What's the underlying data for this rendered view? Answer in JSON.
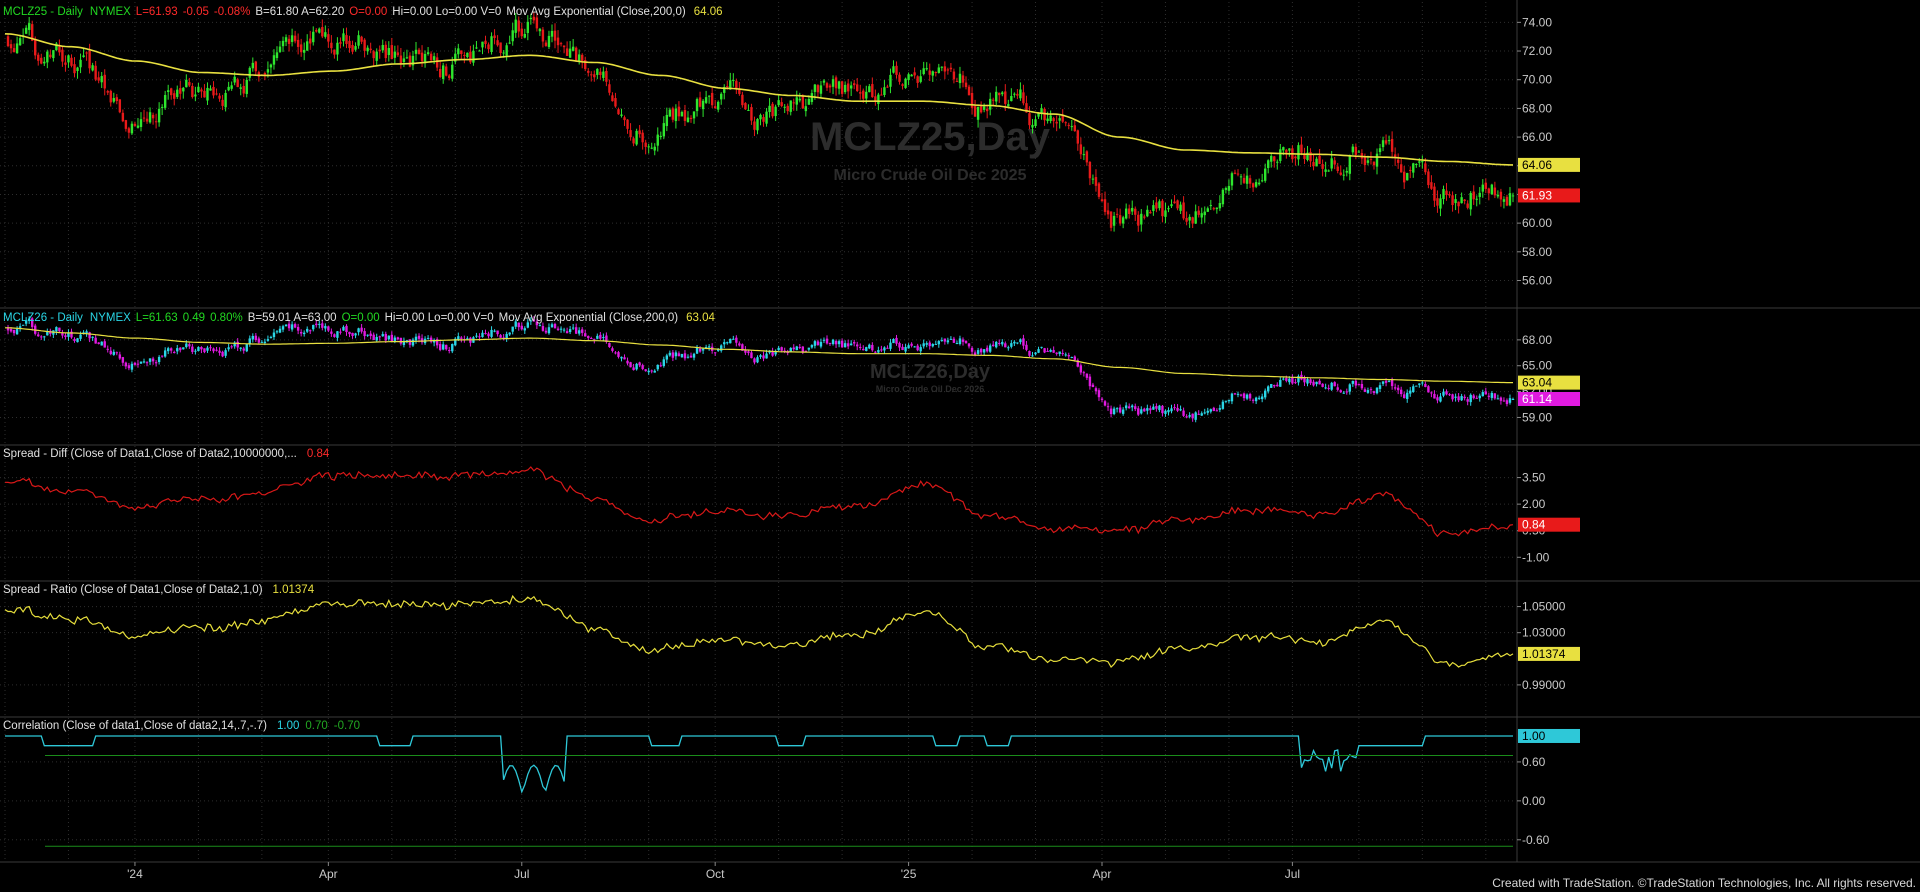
{
  "footer": "Created with TradeStation. ©TradeStation Technologies, Inc. All rights reserved.",
  "colors": {
    "background": "#000000",
    "grid": "#2e2e2e",
    "axis_text": "#c8c8c8",
    "up_bar": "#2ee62e",
    "down_bar": "#e81a1a",
    "ema": "#e8e040",
    "mclz26_up": "#2ad6e6",
    "mclz26_down": "#e01ae0",
    "spread_diff": "#d81818",
    "spread_ratio": "#e6de3c",
    "correlation": "#2ec8d8",
    "corr_levels": "#1a8c1a",
    "green_text": "#22d822",
    "red_text": "#ff2a2a",
    "cyan_text": "#2ad6e6"
  },
  "x_axis": {
    "labels": [
      "'24",
      "Apr",
      "Jul",
      "Oct",
      "'25",
      "Apr",
      "Jul"
    ]
  },
  "panes": [
    {
      "id": "mclz25",
      "header": {
        "symbol": "MCLZ25 - Daily",
        "exchange": "NYMEX",
        "last": "L=61.93",
        "change": "-0.05",
        "pct": "-0.08%",
        "rest": "B=61.80  A=62.20",
        "open": "O=0.00",
        "stats": "Hi=0.00  Lo=0.00  V=0",
        "study": "Mov Avg Exponential (Close,200,0)",
        "study_value": "64.06"
      },
      "watermark": {
        "title": "MCLZ25,Day",
        "subtitle": "Micro Crude Oil Dec 2025"
      },
      "ticks": [
        "74.00",
        "72.00",
        "70.00",
        "68.00",
        "66.00",
        "64.00",
        "62.00",
        "60.00",
        "58.00",
        "56.00"
      ],
      "badges": [
        {
          "text": "64.06",
          "value": 64.06,
          "kind": "ema"
        },
        {
          "text": "61.93",
          "value": 61.93,
          "kind": "last"
        }
      ]
    },
    {
      "id": "mclz26",
      "header": {
        "symbol": "MCLZ26 - Daily",
        "exchange": "NYMEX",
        "last": "L=61.63",
        "change": "0.49",
        "pct": "0.80%",
        "rest": "B=59.01  A=63.00",
        "open": "O=0.00",
        "stats": "Hi=0.00  Lo=0.00  V=0",
        "study": "Mov Avg Exponential (Close,200,0)",
        "study_value": "63.04"
      },
      "watermark": {
        "title": "MCLZ26,Day",
        "subtitle": "Micro Crude Oil Dec 2026"
      },
      "ticks": [
        "68.00",
        "65.00",
        "62.00",
        "59.00"
      ],
      "badges": [
        {
          "text": "63.04",
          "value": 63.04,
          "kind": "ema"
        },
        {
          "text": "61.14",
          "value": 61.14,
          "kind": "last"
        }
      ]
    },
    {
      "id": "diff",
      "header": {
        "label": "Spread - Diff (Close of Data1,Close of Data2,10000000,...",
        "value": "0.84"
      },
      "ticks": [
        "3.50",
        "2.00",
        "0.50",
        "-1.00"
      ],
      "badges": [
        {
          "text": "0.84",
          "value": 0.84,
          "kind": "diff"
        }
      ]
    },
    {
      "id": "ratio",
      "header": {
        "label": "Spread - Ratio (Close of Data1,Close of Data2,1,0)",
        "value": "1.01374"
      },
      "ticks": [
        "1.05000",
        "1.03000",
        "0.99000"
      ],
      "badges": [
        {
          "text": "1.01374",
          "value": 1.01374,
          "kind": "ratio"
        }
      ]
    },
    {
      "id": "corr",
      "header": {
        "label": "Correlation (Close of data1,Close of data2,14,.7,-.7)",
        "v1": "1.00",
        "v2": "0.70",
        "v3": "-0.70"
      },
      "ticks": [
        "0.60",
        "0.00",
        "-0.60"
      ],
      "badges": [
        {
          "text": "1.00",
          "value": 1.0,
          "kind": "corr"
        }
      ]
    }
  ],
  "chart_data": [
    {
      "type": "candlestick",
      "title": "MCLZ25 - Daily NYMEX",
      "ylim": [
        54.5,
        75.0
      ],
      "ema_label": "Mov Avg Exponential (Close,200,0)",
      "ema_last": 64.06,
      "last": 61.93,
      "x_months": [
        "2023-11",
        "2023-12",
        "2024-01",
        "2024-02",
        "2024-03",
        "2024-04",
        "2024-05",
        "2024-06",
        "2024-07",
        "2024-08",
        "2024-09",
        "2024-10",
        "2024-11",
        "2024-12",
        "2025-01",
        "2025-02",
        "2025-03",
        "2025-04",
        "2025-05",
        "2025-06",
        "2025-07",
        "2025-08",
        "2025-09",
        "2025-10"
      ],
      "close_anchors": [
        72.6,
        71.0,
        68.4,
        69.3,
        70.5,
        73.2,
        71.5,
        71.4,
        73.5,
        70.3,
        66.8,
        68.7,
        67.6,
        68.4,
        70.8,
        68.6,
        66.6,
        60.5,
        59.6,
        63.5,
        65.2,
        65.8,
        62.5,
        62.3
      ],
      "ema_anchors": [
        73.2,
        72.3,
        71.3,
        70.5,
        70.3,
        70.6,
        71.1,
        71.4,
        71.7,
        71.2,
        70.3,
        69.4,
        68.9,
        68.5,
        68.5,
        68.2,
        67.6,
        66.0,
        65.1,
        64.9,
        64.8,
        64.6,
        64.3,
        64.06
      ]
    },
    {
      "type": "candlestick",
      "title": "MCLZ26 - Daily NYMEX",
      "ylim": [
        56.5,
        71.0
      ],
      "ema_last": 63.04,
      "last": 61.14,
      "close_anchors": [
        69.3,
        68.3,
        66.4,
        67.0,
        67.9,
        69.5,
        67.9,
        67.8,
        69.6,
        68.1,
        65.6,
        67.1,
        66.3,
        66.6,
        67.6,
        67.3,
        66.1,
        60.0,
        58.6,
        61.8,
        63.7,
        63.2,
        62.1,
        61.4
      ],
      "ema_anchors": [
        69.4,
        68.8,
        68.2,
        67.7,
        67.5,
        67.6,
        67.8,
        68.0,
        68.2,
        67.9,
        67.4,
        66.9,
        66.6,
        66.4,
        66.4,
        66.2,
        65.8,
        64.8,
        64.1,
        63.8,
        63.6,
        63.4,
        63.2,
        63.04
      ]
    },
    {
      "type": "line",
      "title": "Spread - Diff (Close of Data1,Close of Data2,10000000,...",
      "ylim": [
        -2.0,
        5.0
      ],
      "last": 0.84,
      "anchors": [
        3.3,
        2.7,
        2.0,
        2.3,
        2.6,
        3.7,
        3.6,
        3.6,
        3.9,
        2.2,
        1.2,
        1.6,
        1.3,
        1.8,
        3.2,
        1.3,
        0.5,
        0.5,
        1.0,
        1.7,
        1.5,
        2.6,
        0.4,
        0.84
      ]
    },
    {
      "type": "line",
      "title": "Spread - Ratio (Close of Data1,Close of Data2,1,0)",
      "ylim": [
        0.97,
        1.065
      ],
      "last": 1.01374,
      "anchors": [
        1.048,
        1.04,
        1.03,
        1.034,
        1.038,
        1.053,
        1.052,
        1.052,
        1.056,
        1.032,
        1.018,
        1.024,
        1.019,
        1.027,
        1.047,
        1.019,
        1.008,
        1.008,
        1.016,
        1.027,
        1.024,
        1.041,
        1.007,
        1.01374
      ]
    },
    {
      "type": "line",
      "title": "Correlation (Close of data1,Close of data2,14,.7,-.7)",
      "ylim": [
        -0.85,
        1.2
      ],
      "levels": [
        0.7,
        -0.7
      ],
      "last": 1.0
    }
  ]
}
